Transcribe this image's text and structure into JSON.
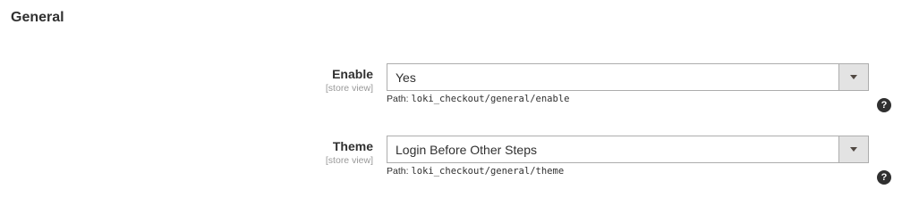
{
  "section": {
    "title": "General"
  },
  "fields": [
    {
      "label": "Enable",
      "scope": "[store view]",
      "value": "Yes",
      "path_prefix": "Path:",
      "path": "loki_checkout/general/enable",
      "help_icon": "question-mark-icon",
      "help_glyph": "?"
    },
    {
      "label": "Theme",
      "scope": "[store view]",
      "value": "Login Before Other Steps",
      "path_prefix": "Path:",
      "path": "loki_checkout/general/theme",
      "help_icon": "question-mark-icon",
      "help_glyph": "?"
    }
  ],
  "colors": {
    "text": "#303030",
    "scope_text": "#999999",
    "select_border": "#adadad",
    "select_toggle_bg": "#e3e3e3",
    "help_icon_bg": "#303030"
  }
}
